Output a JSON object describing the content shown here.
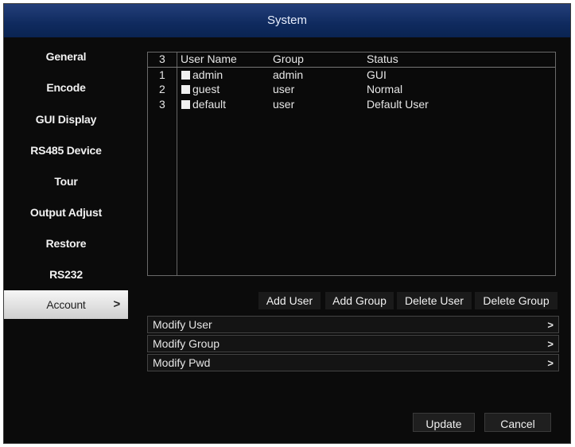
{
  "window": {
    "title": "System"
  },
  "sidebar": {
    "items": [
      {
        "label": "General"
      },
      {
        "label": "Encode"
      },
      {
        "label": "GUI Display"
      },
      {
        "label": "RS485 Device"
      },
      {
        "label": "Tour"
      },
      {
        "label": "Output Adjust"
      },
      {
        "label": "Restore"
      },
      {
        "label": "RS232"
      },
      {
        "label": "Account",
        "active": true,
        "chevron": ">"
      }
    ]
  },
  "user_table": {
    "count": "3",
    "columns": [
      "User Name",
      "Group",
      "Status"
    ],
    "rows": [
      {
        "index": "1",
        "username": "admin",
        "group": "admin",
        "status": "GUI"
      },
      {
        "index": "2",
        "username": "guest",
        "group": "user",
        "status": "Normal"
      },
      {
        "index": "3",
        "username": "default",
        "group": "user",
        "status": "Default User"
      }
    ]
  },
  "actions": {
    "add_user": "Add User",
    "add_group": "Add Group",
    "delete_user": "Delete User",
    "delete_group": "Delete Group"
  },
  "menu": [
    {
      "label": "Modify User",
      "chevron": ">"
    },
    {
      "label": "Modify Group",
      "chevron": ">"
    },
    {
      "label": "Modify Pwd",
      "chevron": ">"
    }
  ],
  "footer": {
    "update": "Update",
    "cancel": "Cancel"
  },
  "colors": {
    "titlebar": "#0f2a5e",
    "background": "#0b0b0b",
    "active_item": "#e0e0e0"
  }
}
